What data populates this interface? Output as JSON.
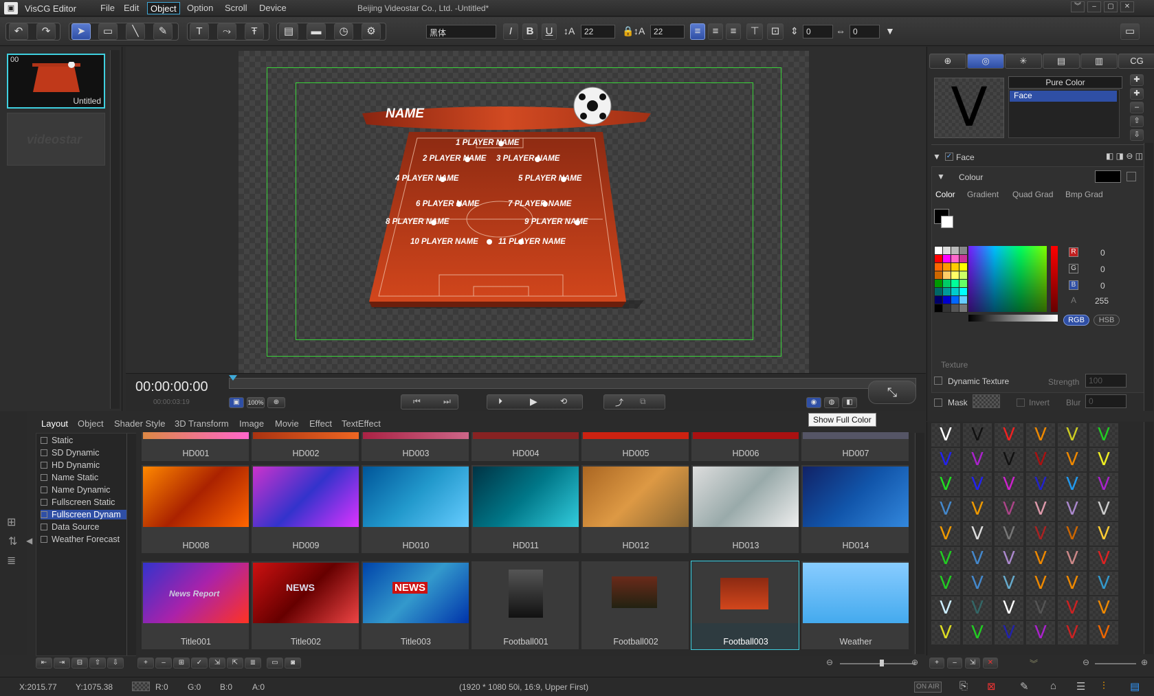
{
  "app": {
    "name": "VisCG Editor",
    "doc_title": "Beijing Videostar Co., Ltd. -Untitled*"
  },
  "menu": [
    "File",
    "Edit",
    "Object",
    "Option",
    "Scroll",
    "Device"
  ],
  "menu_active": "Object",
  "toolbar": {
    "font": "黑体",
    "size1": "22",
    "size2": "22",
    "spacing1": "0",
    "spacing2": "0"
  },
  "pages": [
    {
      "index": "00",
      "label": "Untitled"
    }
  ],
  "watermark": "videostar",
  "scene": {
    "name_label": "NAME",
    "players": [
      "1  PLAYER NAME",
      "2  PLAYER NAME",
      "3  PLAYER NAME",
      "4  PLAYER NAME",
      "5  PLAYER NAME",
      "6  PLAYER NAME",
      "7  PLAYER NAME",
      "8  PLAYER NAME",
      "9  PLAYER NAME",
      "10  PLAYER NAME",
      "11  PLAYER NAME"
    ]
  },
  "timeline": {
    "timecode": "00:00:00:00",
    "duration": "00:00:03:19",
    "zoom": "100%"
  },
  "right": {
    "tabs": [
      "",
      "",
      "",
      "",
      "",
      "CG"
    ],
    "fill_type": "Pure Color",
    "list_item": "Face",
    "face_label": "Face",
    "colour_label": "Colour",
    "color_tabs": [
      "Color",
      "Gradient",
      "Quad Grad",
      "Bmp Grad"
    ],
    "rgb": {
      "r_label": "R",
      "g_label": "G",
      "b_label": "B",
      "a_label": "A",
      "r": "0",
      "g": "0",
      "b": "0",
      "a": "255"
    },
    "mode_rgb": "RGB",
    "mode_hsb": "HSB",
    "texture_label": "Texture",
    "dynamic_texture": "Dynamic Texture",
    "strength_label": "Strength",
    "strength_value": "100",
    "mask_label": "Mask",
    "invert_label": "Invert",
    "blur_label": "Blur",
    "blur_value": "0"
  },
  "tooltip": "Show Full Color",
  "library": {
    "tabs": [
      "Layout",
      "Object",
      "Shader Style",
      "3D Transform",
      "Image",
      "Movie",
      "Effect",
      "TextEffect"
    ],
    "tree": [
      "Static",
      "SD Dynamic",
      "HD Dynamic",
      "Name Static",
      "Name Dynamic",
      "Fullscreen Static",
      "Fullscreen Dynam",
      "Data Source",
      "Weather Forecast"
    ],
    "tree_selected": "Fullscreen Dynam",
    "row0": [
      "HD001",
      "HD002",
      "HD003",
      "HD004",
      "HD005",
      "HD006",
      "HD007"
    ],
    "row1": [
      "HD008",
      "HD009",
      "HD010",
      "HD011",
      "HD012",
      "HD013",
      "HD014"
    ],
    "row2": [
      "Title001",
      "Title002",
      "Title003",
      "Football001",
      "Football002",
      "Football003",
      "Weather"
    ],
    "thumb_text": {
      "news_report": "News Report",
      "news": "NEWS",
      "news3": "NEWS"
    }
  },
  "status": {
    "x": "X:2015.77",
    "y": "Y:1075.38",
    "r": "R:0",
    "g": "G:0",
    "b": "B:0",
    "a": "A:0",
    "format": "(1920 * 1080 50i, 16:9, Upper First)",
    "on_air": "ON AIR"
  },
  "colors": {
    "accent": "#3fd0e0",
    "selection": "#2f4fa5",
    "field_red": "#c0391a",
    "safe_area": "#3ad43a"
  }
}
